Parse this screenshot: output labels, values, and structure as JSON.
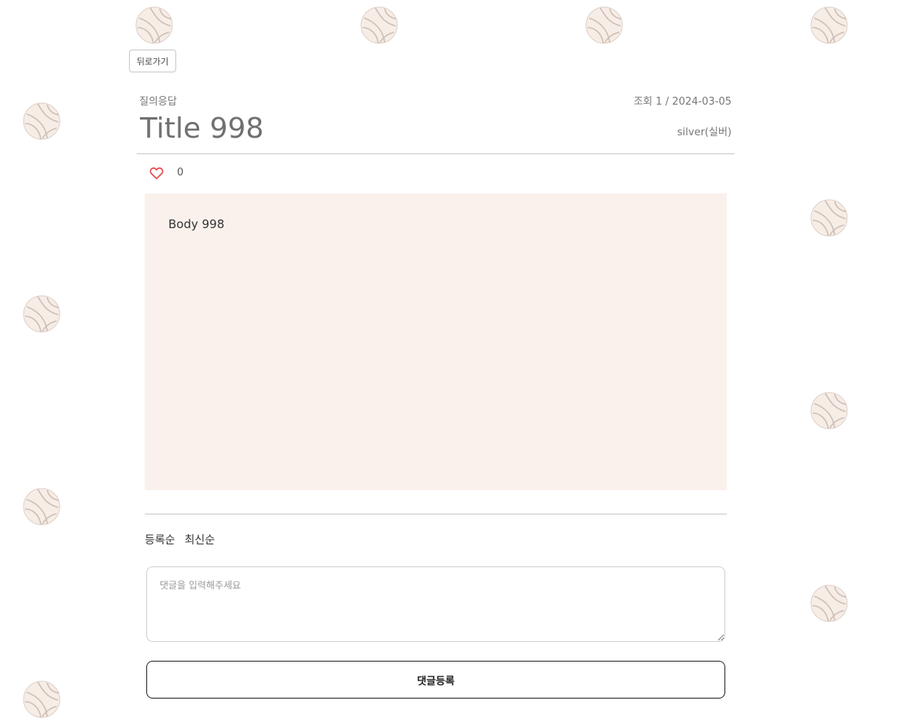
{
  "nav": {
    "back_label": "뒤로가기"
  },
  "post": {
    "category": "질의응답",
    "meta": "조회 1 / 2024-03-05",
    "title": "Title 998",
    "author": "silver(실버)",
    "likes": "0",
    "body": "Body 998"
  },
  "comments": {
    "sort_options": [
      "등록순",
      "최신순"
    ],
    "input_placeholder": "댓글을 입력해주세요",
    "submit_label": "댓글등록"
  },
  "colors": {
    "accent_heart": "#e8474b",
    "body_bg": "#faf1ec"
  },
  "background": {
    "decoration_icon": "volleyball-icon"
  }
}
